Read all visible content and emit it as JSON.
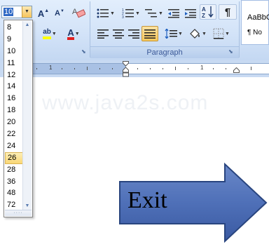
{
  "ribbon": {
    "font_size_value": "10",
    "paragraph_caption": "Paragraph",
    "styles": {
      "sample_text": "AaBbCc",
      "style_name": "¶ No"
    },
    "icons": {
      "grow_font": "A",
      "shrink_font": "A",
      "clear_format": "A",
      "highlight": "ab",
      "font_color": "A",
      "show_marks": "¶"
    }
  },
  "font_size_list": {
    "items": [
      "8",
      "9",
      "10",
      "11",
      "12",
      "14",
      "16",
      "18",
      "20",
      "22",
      "24",
      "26",
      "28",
      "36",
      "48",
      "72"
    ],
    "highlighted": "26"
  },
  "ruler": {
    "numbers": [
      "1",
      "1"
    ]
  },
  "document": {
    "watermark": "www.java2s.com",
    "shape_label": "Exit"
  },
  "colors": {
    "ribbon": "#d3e3f8",
    "arrow_fill": "#4f70b8",
    "arrow_stroke": "#29457f",
    "highlight_yellow": "#ffff00",
    "font_color_red": "#e02020",
    "active_button": "#f7c85c"
  }
}
